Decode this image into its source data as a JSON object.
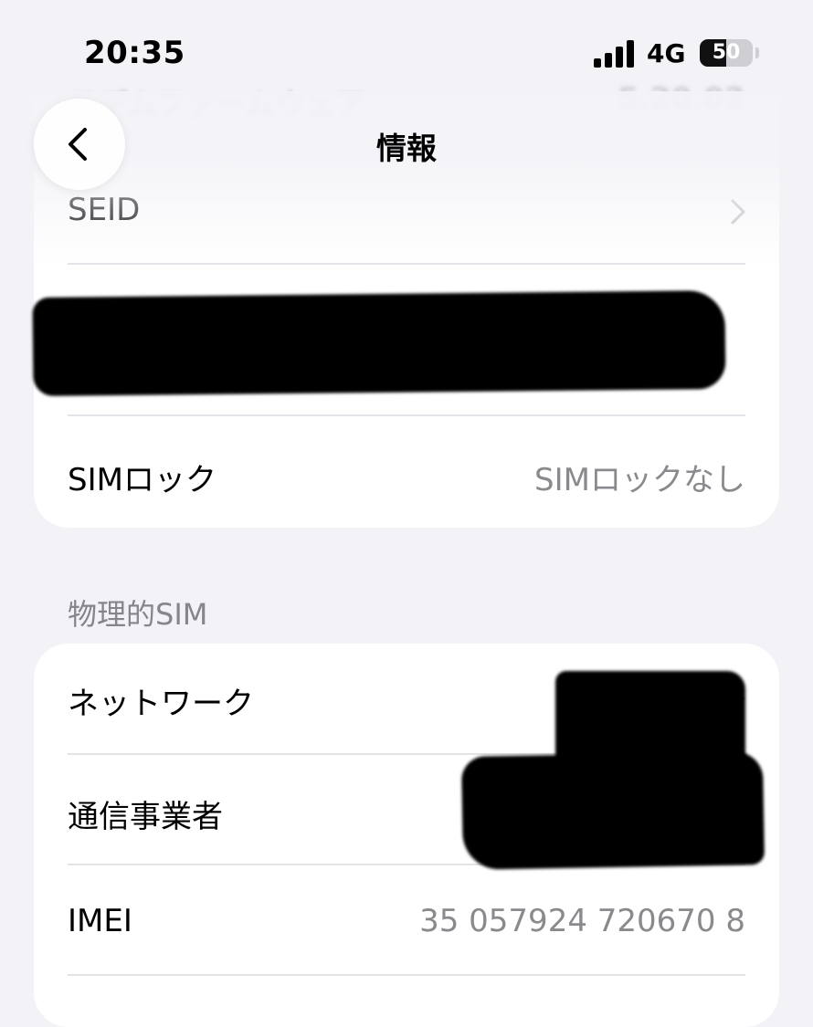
{
  "status_bar": {
    "time": "20:35",
    "network": "4G",
    "battery": "50",
    "battery_level": 0.5
  },
  "background_row": {
    "label": "モデムファームウェア",
    "value": "5.20.02"
  },
  "nav": {
    "title": "情報",
    "back_icon": "chevron-left-icon"
  },
  "top_group": {
    "seid_label": "SEID",
    "sim_lock_label": "SIMロック",
    "sim_lock_value": "SIMロックなし"
  },
  "physical_sim": {
    "header": "物理的SIM",
    "network_label": "ネットワーク",
    "carrier_label": "通信事業者",
    "imei_label": "IMEI",
    "imei_value": "35 057924 720670 8"
  },
  "colors": {
    "background": "#f2f2f7",
    "card": "#ffffff",
    "secondary_text": "#8a8a8e",
    "separator": "#e3e3e8"
  }
}
